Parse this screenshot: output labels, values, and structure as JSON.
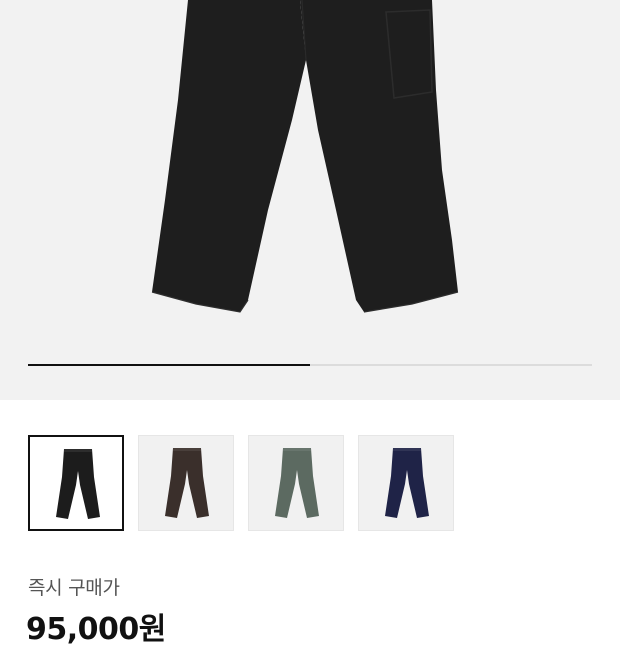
{
  "gallery": {
    "progress": 0.5,
    "main_image": "black-wide-pants-photo",
    "thumbnails": [
      {
        "variant": "black",
        "color": "#1c1c1c",
        "selected": true
      },
      {
        "variant": "brown",
        "color": "#3a2f2b",
        "selected": false
      },
      {
        "variant": "green-gray",
        "color": "#5c6a61",
        "selected": false
      },
      {
        "variant": "navy",
        "color": "#1f2347",
        "selected": false
      }
    ]
  },
  "price": {
    "label": "즉시 구매가",
    "value": "95,000원"
  },
  "colors": {
    "hero_bg": "#f2f2f2",
    "progress_fill": "#111111",
    "progress_track": "#dcdcdc"
  }
}
